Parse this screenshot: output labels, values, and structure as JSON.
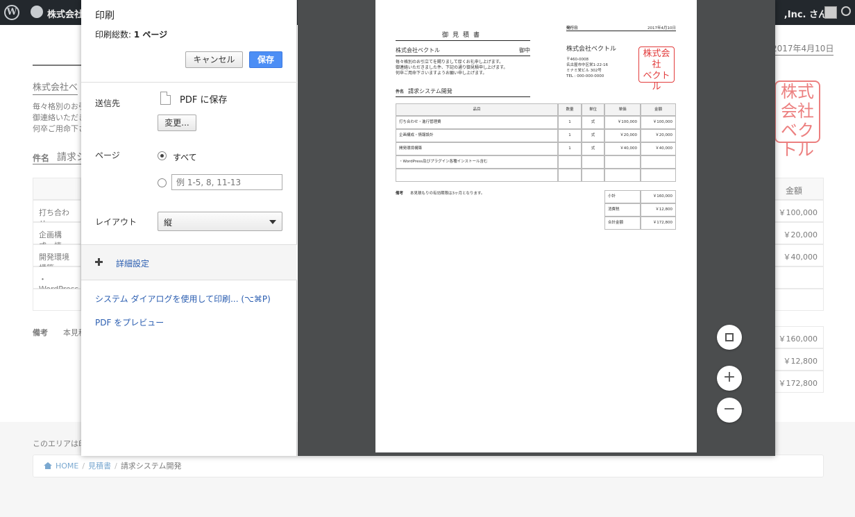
{
  "adminbar": {
    "site_name": "株式会社",
    "howdy": ",Inc. さん",
    "wp_logo_text": "W"
  },
  "background": {
    "date": "2017年4月10日",
    "client": "株式会社ベ",
    "message_lines": [
      "毎々格別のお引",
      "御連絡いただき",
      "何卒ご用命下さ"
    ],
    "subject_label": "件名",
    "subject_value": "請求シ",
    "stamp_text": "株式会社ベクトル",
    "table": {
      "header_amount": "金額",
      "rows": [
        {
          "item": "打ち合わせ・",
          "amount": "￥100,000"
        },
        {
          "item": "企画構成・情",
          "amount": "￥20,000"
        },
        {
          "item": "開発環境構築",
          "amount": "￥40,000"
        },
        {
          "item": "・WordPress",
          "amount": ""
        },
        {
          "item": "",
          "amount": ""
        }
      ],
      "totals": [
        "￥160,000",
        "￥12,800",
        "￥172,800"
      ]
    },
    "remark_label": "備考",
    "remark_value": "本見積",
    "footer_text": "このエリアは印",
    "breadcrumb": {
      "home": "HOME",
      "estimate": "見積書",
      "current": "請求システム開発"
    }
  },
  "print_dialog": {
    "title": "印刷",
    "total_label": "印刷総数:",
    "total_value": "1 ページ",
    "cancel_label": "キャンセル",
    "save_label": "保存",
    "destination_label": "送信先",
    "destination_value": "PDF に保存",
    "change_label": "変更...",
    "pages_label": "ページ",
    "pages_all": "すべて",
    "pages_placeholder": "例 1-5, 8, 11-13",
    "layout_label": "レイアウト",
    "layout_value": "縦",
    "advanced_label": "詳細設定",
    "system_dialog_link": "システム ダイアログを使用して印刷... (⌥⌘P)",
    "pdf_preview_link": "PDF をプレビュー"
  },
  "preview": {
    "title": "御見積書",
    "client": "株式会社ベクトル",
    "client_suffix": "御中",
    "message_lines": [
      "毎々格別のお引立てを賜りまして厚くお礼申し上げます。",
      "御連絡いただきました件、下記の通り御見積申し上げます。",
      "何卒ご用命下さいますようお願い申し上げます。"
    ],
    "subject_label": "件名",
    "subject_value": "請求システム開発",
    "issued_label": "発行日",
    "issued_value": "2017年4月10日",
    "company": "株式会社ベクトル",
    "address_lines": [
      "〒460-0008",
      "名古屋市中区栄1-22-16",
      "ミナミ栄ビル 302号",
      "TEL : 000-000-0000"
    ],
    "stamp_text": "株式会社ベクトル",
    "table": {
      "headers": [
        "品目",
        "数量",
        "単位",
        "単価",
        "金額"
      ],
      "rows": [
        [
          "打ち合わせ・進行管理費",
          "1",
          "式",
          "￥100,000",
          "￥100,000"
        ],
        [
          "企画構成・情報設計",
          "1",
          "式",
          "￥20,000",
          "￥20,000"
        ],
        [
          "開発環境構築",
          "1",
          "式",
          "￥40,000",
          "￥40,000"
        ],
        [
          "・WordPress及びプラグイン各種インストール含む",
          "",
          "",
          "",
          ""
        ],
        [
          "",
          "",
          "",
          "",
          ""
        ]
      ]
    },
    "remark_label": "備考",
    "remark_value": "本見積もりの有効期限は3ヶ月となります。",
    "totals": [
      {
        "label": "小計",
        "value": "￥160,000"
      },
      {
        "label": "消費税",
        "value": "￥12,800"
      },
      {
        "label": "合計金額",
        "value": "￥172,800"
      }
    ]
  },
  "controls": {
    "zoom_in": "+",
    "zoom_out": "−",
    "fit_icon": "fit-to-page-icon"
  }
}
